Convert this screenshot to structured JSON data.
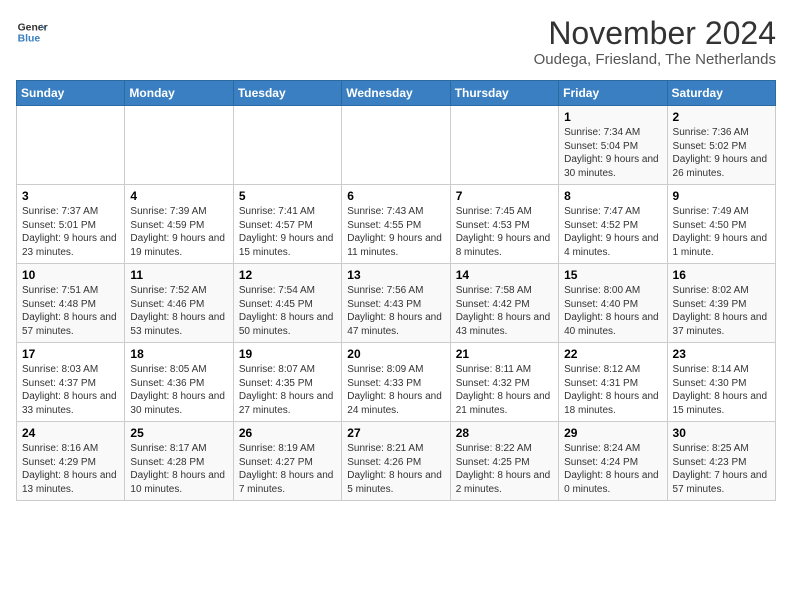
{
  "header": {
    "logo_line1": "General",
    "logo_line2": "Blue",
    "title": "November 2024",
    "subtitle": "Oudega, Friesland, The Netherlands"
  },
  "calendar": {
    "days_of_week": [
      "Sunday",
      "Monday",
      "Tuesday",
      "Wednesday",
      "Thursday",
      "Friday",
      "Saturday"
    ],
    "weeks": [
      [
        {
          "day": "",
          "content": ""
        },
        {
          "day": "",
          "content": ""
        },
        {
          "day": "",
          "content": ""
        },
        {
          "day": "",
          "content": ""
        },
        {
          "day": "",
          "content": ""
        },
        {
          "day": "1",
          "content": "Sunrise: 7:34 AM\nSunset: 5:04 PM\nDaylight: 9 hours and 30 minutes."
        },
        {
          "day": "2",
          "content": "Sunrise: 7:36 AM\nSunset: 5:02 PM\nDaylight: 9 hours and 26 minutes."
        }
      ],
      [
        {
          "day": "3",
          "content": "Sunrise: 7:37 AM\nSunset: 5:01 PM\nDaylight: 9 hours and 23 minutes."
        },
        {
          "day": "4",
          "content": "Sunrise: 7:39 AM\nSunset: 4:59 PM\nDaylight: 9 hours and 19 minutes."
        },
        {
          "day": "5",
          "content": "Sunrise: 7:41 AM\nSunset: 4:57 PM\nDaylight: 9 hours and 15 minutes."
        },
        {
          "day": "6",
          "content": "Sunrise: 7:43 AM\nSunset: 4:55 PM\nDaylight: 9 hours and 11 minutes."
        },
        {
          "day": "7",
          "content": "Sunrise: 7:45 AM\nSunset: 4:53 PM\nDaylight: 9 hours and 8 minutes."
        },
        {
          "day": "8",
          "content": "Sunrise: 7:47 AM\nSunset: 4:52 PM\nDaylight: 9 hours and 4 minutes."
        },
        {
          "day": "9",
          "content": "Sunrise: 7:49 AM\nSunset: 4:50 PM\nDaylight: 9 hours and 1 minute."
        }
      ],
      [
        {
          "day": "10",
          "content": "Sunrise: 7:51 AM\nSunset: 4:48 PM\nDaylight: 8 hours and 57 minutes."
        },
        {
          "day": "11",
          "content": "Sunrise: 7:52 AM\nSunset: 4:46 PM\nDaylight: 8 hours and 53 minutes."
        },
        {
          "day": "12",
          "content": "Sunrise: 7:54 AM\nSunset: 4:45 PM\nDaylight: 8 hours and 50 minutes."
        },
        {
          "day": "13",
          "content": "Sunrise: 7:56 AM\nSunset: 4:43 PM\nDaylight: 8 hours and 47 minutes."
        },
        {
          "day": "14",
          "content": "Sunrise: 7:58 AM\nSunset: 4:42 PM\nDaylight: 8 hours and 43 minutes."
        },
        {
          "day": "15",
          "content": "Sunrise: 8:00 AM\nSunset: 4:40 PM\nDaylight: 8 hours and 40 minutes."
        },
        {
          "day": "16",
          "content": "Sunrise: 8:02 AM\nSunset: 4:39 PM\nDaylight: 8 hours and 37 minutes."
        }
      ],
      [
        {
          "day": "17",
          "content": "Sunrise: 8:03 AM\nSunset: 4:37 PM\nDaylight: 8 hours and 33 minutes."
        },
        {
          "day": "18",
          "content": "Sunrise: 8:05 AM\nSunset: 4:36 PM\nDaylight: 8 hours and 30 minutes."
        },
        {
          "day": "19",
          "content": "Sunrise: 8:07 AM\nSunset: 4:35 PM\nDaylight: 8 hours and 27 minutes."
        },
        {
          "day": "20",
          "content": "Sunrise: 8:09 AM\nSunset: 4:33 PM\nDaylight: 8 hours and 24 minutes."
        },
        {
          "day": "21",
          "content": "Sunrise: 8:11 AM\nSunset: 4:32 PM\nDaylight: 8 hours and 21 minutes."
        },
        {
          "day": "22",
          "content": "Sunrise: 8:12 AM\nSunset: 4:31 PM\nDaylight: 8 hours and 18 minutes."
        },
        {
          "day": "23",
          "content": "Sunrise: 8:14 AM\nSunset: 4:30 PM\nDaylight: 8 hours and 15 minutes."
        }
      ],
      [
        {
          "day": "24",
          "content": "Sunrise: 8:16 AM\nSunset: 4:29 PM\nDaylight: 8 hours and 13 minutes."
        },
        {
          "day": "25",
          "content": "Sunrise: 8:17 AM\nSunset: 4:28 PM\nDaylight: 8 hours and 10 minutes."
        },
        {
          "day": "26",
          "content": "Sunrise: 8:19 AM\nSunset: 4:27 PM\nDaylight: 8 hours and 7 minutes."
        },
        {
          "day": "27",
          "content": "Sunrise: 8:21 AM\nSunset: 4:26 PM\nDaylight: 8 hours and 5 minutes."
        },
        {
          "day": "28",
          "content": "Sunrise: 8:22 AM\nSunset: 4:25 PM\nDaylight: 8 hours and 2 minutes."
        },
        {
          "day": "29",
          "content": "Sunrise: 8:24 AM\nSunset: 4:24 PM\nDaylight: 8 hours and 0 minutes."
        },
        {
          "day": "30",
          "content": "Sunrise: 8:25 AM\nSunset: 4:23 PM\nDaylight: 7 hours and 57 minutes."
        }
      ]
    ]
  }
}
